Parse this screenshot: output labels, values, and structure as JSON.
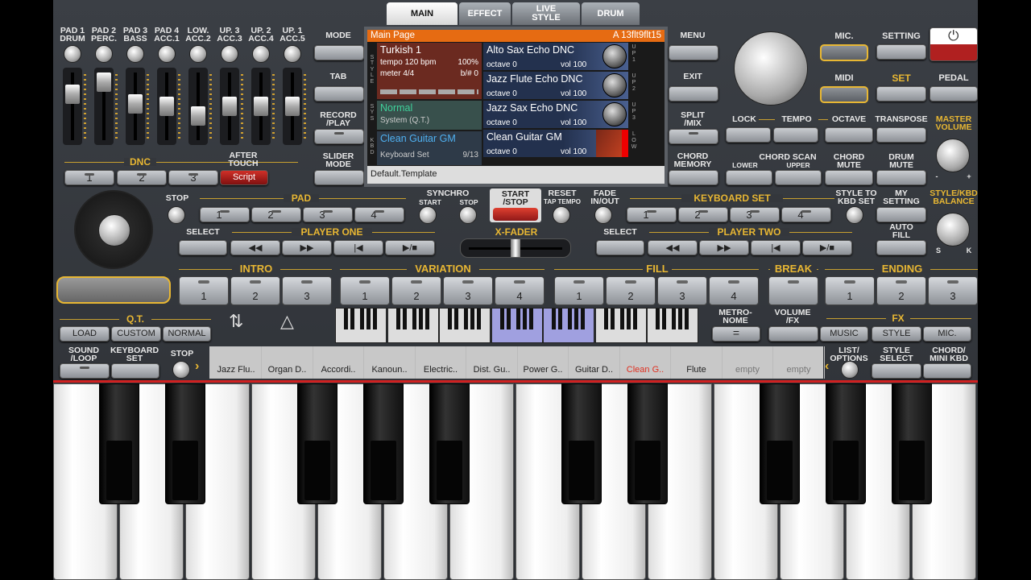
{
  "tabs": [
    "MAIN",
    "EFFECT",
    "LIVE\nSTYLE",
    "DRUM"
  ],
  "pads": [
    "PAD 1\nDRUM",
    "PAD 2\nPERC.",
    "PAD 3\nBASS",
    "PAD 4\nACC.1",
    "LOW.\nACC.2",
    "UP. 3\nACC.3",
    "UP. 2\nACC.4",
    "UP. 1\nACC.5"
  ],
  "fader_levels": [
    0.75,
    1.0,
    0.55,
    0.5,
    0.3,
    0.5,
    0.5,
    0.5
  ],
  "dnc": {
    "label": "DNC",
    "buttons": [
      "1",
      "2",
      "3"
    ],
    "after_touch": "AFTER\nTOUCH",
    "script": "Script"
  },
  "left_buttons": [
    "MODE",
    "TAB",
    "RECORD\n/PLAY",
    "SLIDER\nMODE"
  ],
  "right_buttons": [
    "MENU",
    "EXIT",
    "SPLIT\n/MIX",
    "CHORD\nMEMORY"
  ],
  "screen": {
    "title": "Main Page",
    "code": "A 13flt9flt15",
    "style_name": "Turkish 1",
    "tempo": "tempo 120 bpm",
    "percent": "100%",
    "meter": "meter 4/4",
    "bsharp": "b/# 0",
    "sys_name": "Normal",
    "sys_sub": "System (Q.T.)",
    "kbd_name": "Clean Guitar GM",
    "kbd_sub": "Keyboard Set",
    "kbd_count": "9/13",
    "template": "Default.Template",
    "side_style": "S\nT\nY\nL\nE",
    "side_sys": "S\nY\nS",
    "side_kbd": "K\nB\nD",
    "voices": [
      {
        "name": "Alto Sax Echo DNC",
        "octave": "octave 0",
        "vol": "vol 100",
        "tag": "U\nP\n1"
      },
      {
        "name": "Jazz Flute Echo DNC",
        "octave": "octave 0",
        "vol": "vol 100",
        "tag": "U\nP\n2"
      },
      {
        "name": "Jazz Sax Echo DNC",
        "octave": "octave 0",
        "vol": "vol 100",
        "tag": "U\nP\n3"
      },
      {
        "name": "Clean Guitar GM",
        "octave": "octave 0",
        "vol": "vol 100",
        "tag": "L\nO\nW"
      }
    ]
  },
  "top_right": {
    "mic": "MIC.",
    "setting": "SETTING",
    "midi": "MIDI",
    "set": "SET",
    "pedal": "PEDAL",
    "lock": "LOCK",
    "tempo": "TEMPO",
    "octave": "OCTAVE",
    "transpose": "TRANSPOSE",
    "master": "MASTER\nVOLUME",
    "chord_scan": "CHORD SCAN",
    "lower": "LOWER",
    "upper": "UPPER",
    "chord_mute": "CHORD\nMUTE",
    "drum_mute": "DRUM\nMUTE",
    "minus": "-",
    "plus": "+"
  },
  "row_pad": {
    "stop": "STOP",
    "pad": "PAD",
    "pads": [
      "1",
      "2",
      "3",
      "4"
    ],
    "synchro": "SYNCHRO",
    "start": "START",
    "stop2": "STOP",
    "start_stop": "START\n/STOP",
    "reset": "RESET",
    "tap_tempo": "TAP TEMPO",
    "fade": "FADE\nIN/OUT",
    "kbd_set": "KEYBOARD SET",
    "kbd_nums": [
      "1",
      "2",
      "3",
      "4"
    ],
    "style_to": "STYLE TO\nKBD SET",
    "my_setting": "MY\nSETTING",
    "balance": "STYLE/KBD\nBALANCE"
  },
  "players": {
    "select": "SELECT",
    "player_one": "PLAYER ONE",
    "xfader": "X-FADER",
    "select2": "SELECT",
    "player_two": "PLAYER TWO",
    "auto_fill": "AUTO\nFILL",
    "s": "S",
    "k": "K"
  },
  "sections": {
    "intro": "INTRO",
    "intro_nums": [
      "1",
      "2",
      "3"
    ],
    "variation": "VARIATION",
    "var_nums": [
      "1",
      "2",
      "3",
      "4"
    ],
    "fill": "FILL",
    "fill_nums": [
      "1",
      "2",
      "3",
      "4"
    ],
    "break": "BREAK",
    "ending": "ENDING",
    "end_nums": [
      "1",
      "2",
      "3"
    ]
  },
  "qt": {
    "label": "Q.T.",
    "load": "LOAD",
    "custom": "CUSTOM",
    "normal": "NORMAL",
    "metronome": "METRO-\nNOME",
    "volume_fx": "VOLUME\n/FX",
    "fx": "FX",
    "music": "MUSIC",
    "style": "STYLE",
    "mic": "MIC."
  },
  "bottom": {
    "sound_loop": "SOUND\n/LOOP",
    "kbd_set": "KEYBOARD\nSET",
    "stop": "STOP",
    "list": "LIST/\nOPTIONS",
    "style_select": "STYLE\nSELECT",
    "chord_mini": "CHORD/\nMINI KBD"
  },
  "sounds": [
    "Jazz Flu..",
    "Organ D..",
    "Accordi..",
    "Kanoun..",
    "Electric..",
    "Dist. Gu..",
    "Power G..",
    "Guitar D..",
    "Clean G..",
    "Flute",
    "empty",
    "empty"
  ],
  "colors": {
    "accent": "#e8b733",
    "screen_header": "#e66b12",
    "selected_sound": "#e03020",
    "sys_text": "#3fd09a",
    "kbd_text": "#4fb0f0"
  }
}
